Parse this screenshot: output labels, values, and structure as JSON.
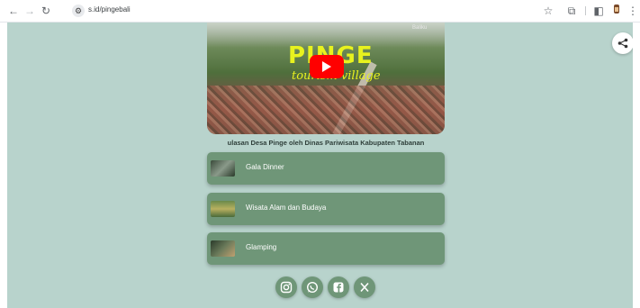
{
  "browser": {
    "url": "s.id/pingebali",
    "icons": [
      "back-icon",
      "forward-icon",
      "reload-icon",
      "site-info-icon",
      "star-icon",
      "extensions-icon",
      "sidebar-icon",
      "profile-icon",
      "menu-icon"
    ]
  },
  "page": {
    "background": "#b8d3cc",
    "accent": "#6f9678",
    "video": {
      "title": "PINGE",
      "subtitle": "tourism village",
      "channel_tag": "Baliku",
      "caption": "ulasan Desa Pinge oleh Dinas Pariwisata Kabupaten Tabanan"
    },
    "links": [
      {
        "label": "Gala Dinner",
        "thumb": "gala-dinner-thumbnail"
      },
      {
        "label": "Wisata Alam dan Budaya",
        "thumb": "wisata-alam-thumbnail"
      },
      {
        "label": "Glamping",
        "thumb": "glamping-thumbnail"
      }
    ],
    "social": [
      "instagram-icon",
      "whatsapp-icon",
      "facebook-icon",
      "x-icon"
    ]
  }
}
